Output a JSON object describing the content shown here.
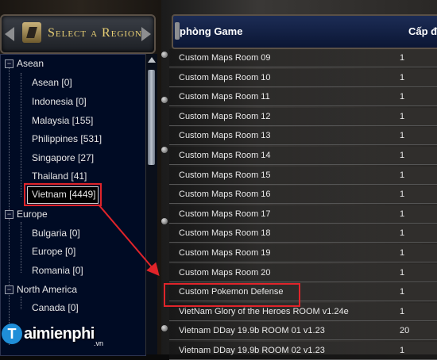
{
  "region_panel": {
    "title": "Select a Region",
    "tree": [
      {
        "label": "Asean",
        "expanded": true,
        "children": [
          {
            "label": "Asean [0]"
          },
          {
            "label": "Indonesia [0]"
          },
          {
            "label": "Malaysia [155]"
          },
          {
            "label": "Philippines [531]"
          },
          {
            "label": "Singapore [27]"
          },
          {
            "label": "Thailand [41]"
          },
          {
            "label": "Vietnam [4449]",
            "selected": true
          }
        ]
      },
      {
        "label": "Europe",
        "expanded": true,
        "children": [
          {
            "label": "Bulgaria [0]"
          },
          {
            "label": "Europe [0]"
          },
          {
            "label": "Romania [0]"
          }
        ]
      },
      {
        "label": "North America",
        "expanded": true,
        "children": [
          {
            "label": "Canada [0]"
          }
        ]
      }
    ],
    "expand_glyph": "−"
  },
  "logo": {
    "circle": "T",
    "text": "aimienphi",
    "suffix": ".vn"
  },
  "game_list": {
    "columns": {
      "name": "phòng Game",
      "level": "Cấp độ đ"
    },
    "rows": [
      {
        "name": "Custom Maps Room 09",
        "count": "1"
      },
      {
        "name": "Custom Maps Room 10",
        "count": "1"
      },
      {
        "name": "Custom Maps Room 11",
        "count": "1"
      },
      {
        "name": "Custom Maps Room 12",
        "count": "1"
      },
      {
        "name": "Custom Maps Room 13",
        "count": "1"
      },
      {
        "name": "Custom Maps Room 14",
        "count": "1"
      },
      {
        "name": "Custom Maps Room 15",
        "count": "1"
      },
      {
        "name": "Custom Maps Room 16",
        "count": "1"
      },
      {
        "name": "Custom Maps Room 17",
        "count": "1"
      },
      {
        "name": "Custom Maps Room 18",
        "count": "1"
      },
      {
        "name": "Custom Maps Room 19",
        "count": "1"
      },
      {
        "name": "Custom Maps Room 20",
        "count": "1"
      },
      {
        "name": "Custom Pokemon Defense",
        "count": "1",
        "highlighted": true
      },
      {
        "name": "VietNam Glory of the Heroes ROOM v1.24e",
        "count": "1"
      },
      {
        "name": "Vietnam DDay 19.9b ROOM 01 v1.23",
        "count": "20"
      },
      {
        "name": "Vietnam DDay 19.9b ROOM 02 v1.23",
        "count": "1"
      }
    ]
  },
  "colors": {
    "highlight": "#e0242a",
    "title_gold": "#e8cf74",
    "tree_bg": "#000b24"
  }
}
